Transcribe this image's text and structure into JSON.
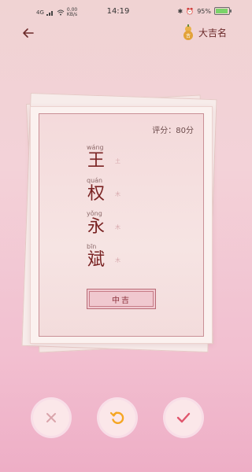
{
  "status": {
    "network": "4G",
    "speed": "0.00",
    "speed_unit": "KB/s",
    "time": "14:19",
    "battery": "95%",
    "battery_level": 0.95,
    "battery_color": "#7bd36a"
  },
  "header": {
    "brand": "大吉名"
  },
  "card": {
    "score_label": "评分：",
    "score_value": "80分",
    "characters": [
      {
        "pinyin": "wáng",
        "hanzi": "王",
        "element": "土"
      },
      {
        "pinyin": "quán",
        "hanzi": "权",
        "element": "木"
      },
      {
        "pinyin": "yǒng",
        "hanzi": "永",
        "element": "木"
      },
      {
        "pinyin": "bīn",
        "hanzi": "斌",
        "element": "木"
      }
    ],
    "verdict": "中吉"
  },
  "actions": [
    {
      "name": "reject-button",
      "icon": "close-icon",
      "color": "#d9a4ab"
    },
    {
      "name": "refresh-button",
      "icon": "refresh-icon",
      "color": "#f5a623"
    },
    {
      "name": "accept-button",
      "icon": "check-icon",
      "color": "#e0566d"
    }
  ]
}
